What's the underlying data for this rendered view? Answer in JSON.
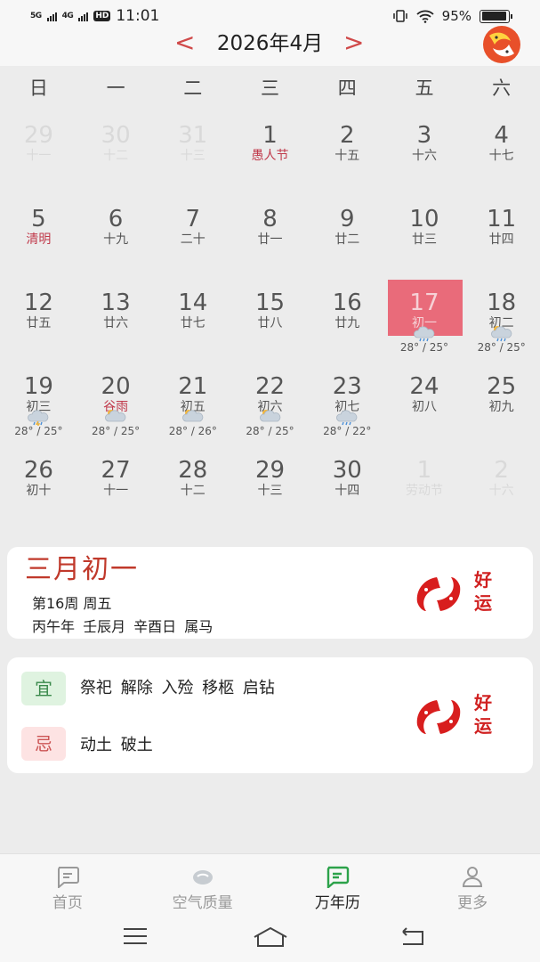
{
  "status_bar": {
    "signal_1": "5G",
    "signal_2": "4G",
    "hd_label": "HD",
    "time": "11:01",
    "battery": "95%",
    "battery_level": 0.95
  },
  "header": {
    "title": "2026年4月",
    "prev_arrow": "<",
    "next_arrow": ">",
    "logo_icon": "koi-fish-logo-icon"
  },
  "weekdays": [
    "日",
    "一",
    "二",
    "三",
    "四",
    "五",
    "六"
  ],
  "calendar": {
    "weeks": [
      [
        {
          "day": "29",
          "lunar": "十一",
          "other": true
        },
        {
          "day": "30",
          "lunar": "十二",
          "other": true
        },
        {
          "day": "31",
          "lunar": "十三",
          "other": true
        },
        {
          "day": "1",
          "lunar": "愚人节",
          "festival": true
        },
        {
          "day": "2",
          "lunar": "十五"
        },
        {
          "day": "3",
          "lunar": "十六"
        },
        {
          "day": "4",
          "lunar": "十七"
        }
      ],
      [
        {
          "day": "5",
          "lunar": "清明",
          "festival": true
        },
        {
          "day": "6",
          "lunar": "十九"
        },
        {
          "day": "7",
          "lunar": "二十"
        },
        {
          "day": "8",
          "lunar": "廿一"
        },
        {
          "day": "9",
          "lunar": "廿二"
        },
        {
          "day": "10",
          "lunar": "廿三"
        },
        {
          "day": "11",
          "lunar": "廿四"
        }
      ],
      [
        {
          "day": "12",
          "lunar": "廿五"
        },
        {
          "day": "13",
          "lunar": "廿六"
        },
        {
          "day": "14",
          "lunar": "廿七"
        },
        {
          "day": "15",
          "lunar": "廿八"
        },
        {
          "day": "16",
          "lunar": "廿九"
        },
        {
          "day": "17",
          "lunar": "初一",
          "selected": true,
          "weather": {
            "icon": "cloudy-rain-icon",
            "temp": "28° / 25°"
          }
        },
        {
          "day": "18",
          "lunar": "初二",
          "weather": {
            "icon": "sun-cloud-rain-icon",
            "temp": "28° / 25°"
          }
        }
      ],
      [
        {
          "day": "19",
          "lunar": "初三",
          "weather": {
            "icon": "thunder-rain-icon",
            "temp": "28° / 25°"
          }
        },
        {
          "day": "20",
          "lunar": "谷雨",
          "festival": true,
          "weather": {
            "icon": "partly-cloudy-icon",
            "temp": "28° / 25°"
          }
        },
        {
          "day": "21",
          "lunar": "初五",
          "weather": {
            "icon": "partly-cloudy-icon",
            "temp": "28° / 26°"
          }
        },
        {
          "day": "22",
          "lunar": "初六",
          "weather": {
            "icon": "partly-cloudy-icon",
            "temp": "28° / 25°"
          }
        },
        {
          "day": "23",
          "lunar": "初七",
          "weather": {
            "icon": "cloudy-rain-icon",
            "temp": "28° / 22°"
          }
        },
        {
          "day": "24",
          "lunar": "初八"
        },
        {
          "day": "25",
          "lunar": "初九"
        }
      ],
      [
        {
          "day": "26",
          "lunar": "初十"
        },
        {
          "day": "27",
          "lunar": "十一"
        },
        {
          "day": "28",
          "lunar": "十二"
        },
        {
          "day": "29",
          "lunar": "十三"
        },
        {
          "day": "30",
          "lunar": "十四"
        },
        {
          "day": "1",
          "lunar": "劳动节",
          "other": true
        },
        {
          "day": "2",
          "lunar": "十六",
          "other": true
        }
      ]
    ]
  },
  "info": {
    "lunar_date": "三月初一",
    "week_info": "第16周  周五",
    "ganzhi": "丙午年 壬辰月 辛酉日 属马",
    "lucky_text_1": "好",
    "lucky_text_2": "运"
  },
  "yiji": {
    "yi_label": "宜",
    "yi_items": "祭祀 解除 入殓 移柩 启钻",
    "ji_label": "忌",
    "ji_items": "动土 破土",
    "lucky_text_1": "好",
    "lucky_text_2": "运"
  },
  "bottom_nav": [
    {
      "label": "首页",
      "icon": "home-chat-icon",
      "active": false
    },
    {
      "label": "空气质量",
      "icon": "air-quality-icon",
      "active": false
    },
    {
      "label": "万年历",
      "icon": "calendar-icon",
      "active": true
    },
    {
      "label": "更多",
      "icon": "person-icon",
      "active": false
    }
  ],
  "colors": {
    "accent_red": "#c0392b",
    "selected_day": "#e96b7a",
    "active_nav": "#2ca24a"
  }
}
